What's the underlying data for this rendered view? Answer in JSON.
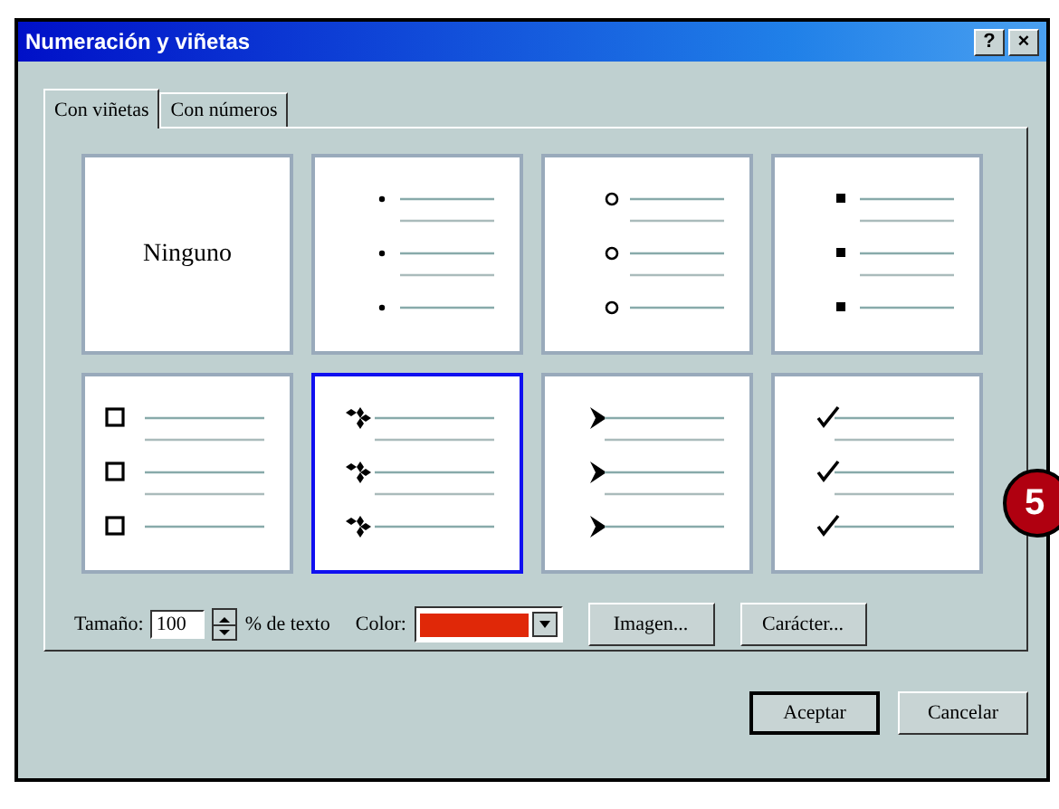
{
  "window": {
    "title": "Numeración y viñetas",
    "help": "?",
    "close": "×"
  },
  "tabs": [
    {
      "label": "Con viñetas",
      "selected": true
    },
    {
      "label": "Con números",
      "selected": false
    }
  ],
  "bullet_styles": [
    {
      "kind": "none",
      "label": "Ninguno",
      "selected": false
    },
    {
      "kind": "dot",
      "selected": false
    },
    {
      "kind": "circle",
      "selected": false
    },
    {
      "kind": "square",
      "selected": false
    },
    {
      "kind": "hollow-square",
      "selected": false
    },
    {
      "kind": "diamonds",
      "selected": true
    },
    {
      "kind": "arrow",
      "selected": false
    },
    {
      "kind": "check",
      "selected": false
    }
  ],
  "size": {
    "label": "Tamaño:",
    "value": "100",
    "suffix": "% de texto"
  },
  "color": {
    "label": "Color:",
    "color": "#e02808"
  },
  "buttons": [
    "Imagen...",
    "Carácter..."
  ],
  "dialog_buttons": [
    {
      "label": "Aceptar",
      "default": true
    },
    {
      "label": "Cancelar",
      "default": false
    }
  ],
  "callout": "5"
}
